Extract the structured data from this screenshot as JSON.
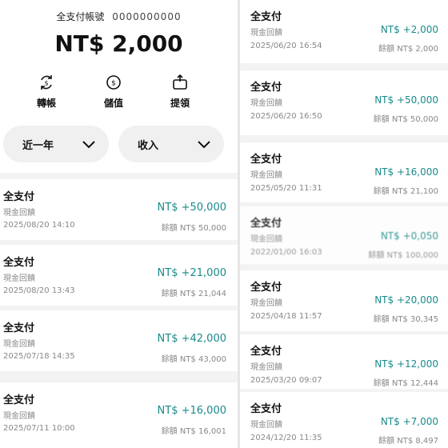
{
  "left": {
    "header": {
      "account_label": "全支付帳號",
      "account_masked": "0000000000",
      "balance": "NT$ 2,000"
    },
    "actions": [
      {
        "label": "轉帳",
        "icon": "transfer-icon"
      },
      {
        "label": "儲值",
        "icon": "topup-icon"
      },
      {
        "label": "提領",
        "icon": "withdraw-icon"
      }
    ],
    "filters": {
      "period": "近一年",
      "type": "收入"
    },
    "transactions": [
      {
        "merchant": "全支付",
        "desc": "現金回饋",
        "amount": "NT$ +50,000",
        "datetime": "2025/08/20 14:10",
        "balance": "餘額 NT$ 50,000"
      },
      {
        "merchant": "全支付",
        "desc": "現金回饋",
        "amount": "NT$ +21,000",
        "datetime": "2025/08/20 13:43",
        "balance": "餘額 NT$ 21,044"
      },
      {
        "merchant": "全支付",
        "desc": "現金回饋",
        "amount": "NT$ +42,000",
        "datetime": "2025/07/18 14:35",
        "balance": "餘額 NT$ 43,000"
      },
      {
        "merchant": "全支付",
        "desc": "現金回饋",
        "amount": "NT$ +16,000",
        "datetime": "2025/07/11 10:00",
        "balance": "餘額 NT$ 16,001"
      }
    ]
  },
  "right": {
    "transactions": [
      {
        "merchant": "全支付",
        "desc": "現金回饋",
        "amount": "NT$ +2,000",
        "datetime": "2025/06/20 16:54",
        "balance": "餘額 NT$ 2,000"
      },
      {
        "merchant": "全支付",
        "desc": "現金回饋",
        "amount": "NT$ +50,000",
        "datetime": "2025/06/20 16:50",
        "balance": "餘額 NT$ 50,000"
      },
      {
        "merchant": "全支付",
        "desc": "現金回饋",
        "amount": "NT$ +16,000",
        "datetime": "2025/05/20 11:31",
        "balance": "餘額 NT$ 21,100"
      },
      {
        "merchant": "全支付",
        "desc": "現金回饋",
        "amount": "NT$ +0,050",
        "datetime": "2022/01/00 16:03",
        "balance": "餘額 NT$ 100,000"
      },
      {
        "merchant": "全支付",
        "desc": "現金回饋",
        "amount": "NT$ +20,000",
        "datetime": "2025/04/18 11:57",
        "balance": "餘額 NT$ 30,345"
      },
      {
        "merchant": "全支付",
        "desc": "現金回饋",
        "amount": "NT$ +12,000",
        "datetime": "2025/03/20 09:07",
        "balance": "餘額 NT$ 12,444"
      },
      {
        "merchant": "全支付",
        "desc": "現金回饋",
        "amount": "NT$ +7,000",
        "datetime": "2024/12/20 11:35",
        "balance": "餘額 NT$ 8,497"
      }
    ]
  },
  "colors": {
    "amount": "#1a8a8a",
    "muted": "#888888",
    "background": "#f3f3f3"
  }
}
